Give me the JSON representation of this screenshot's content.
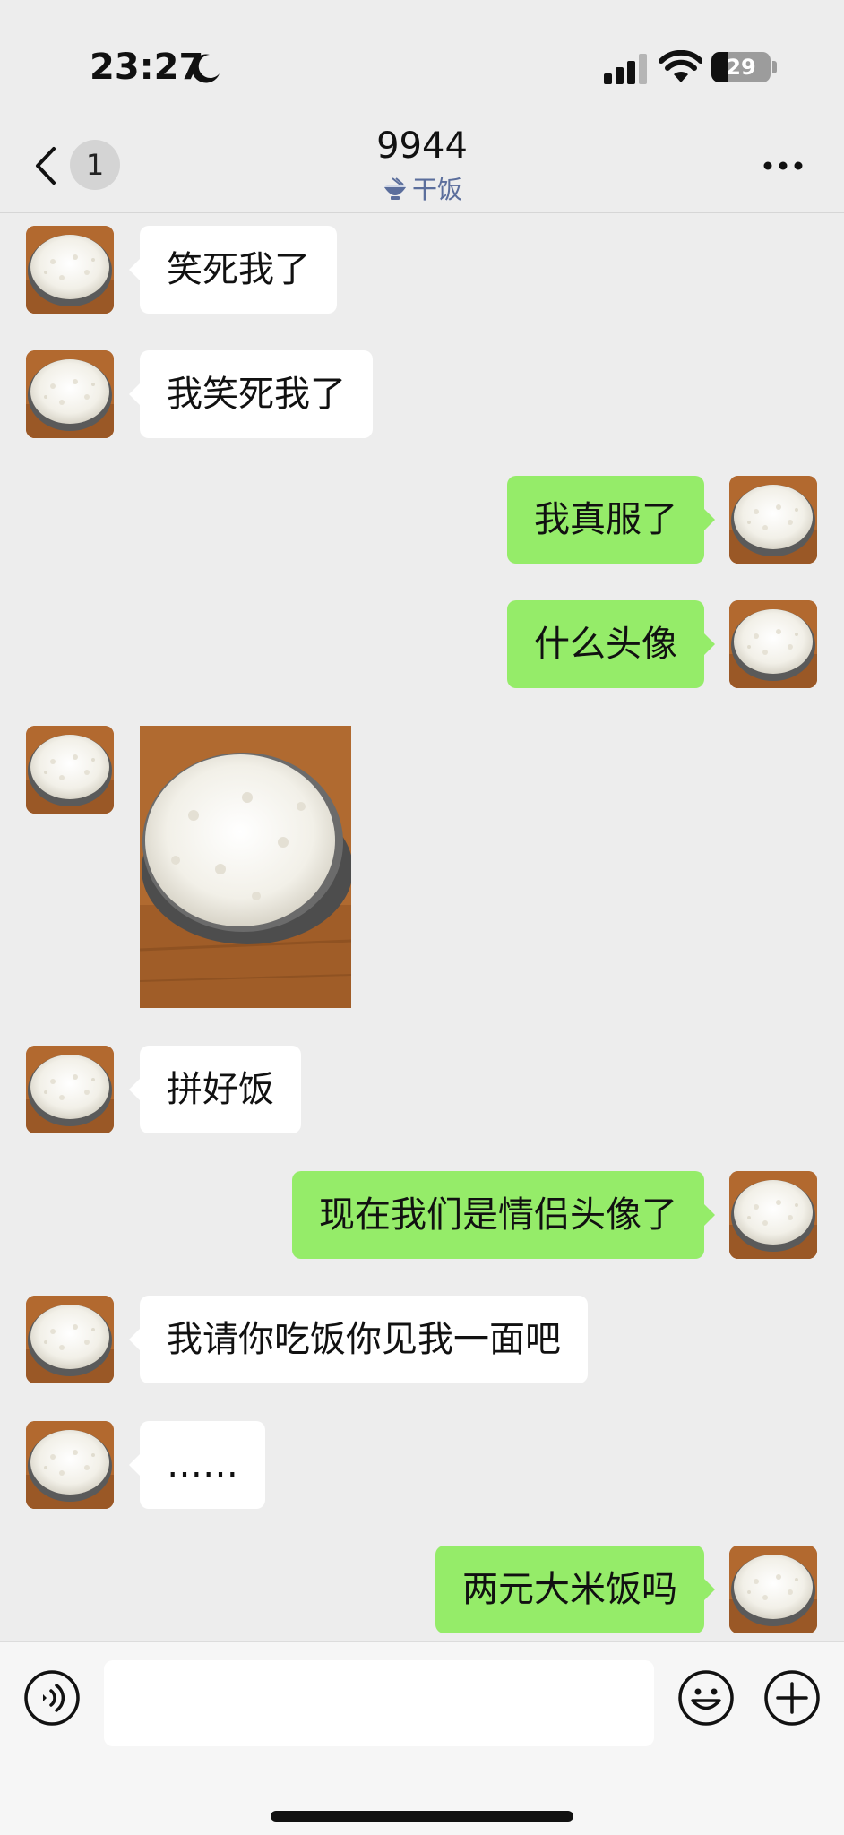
{
  "status_bar": {
    "time": "23:27",
    "battery": "29"
  },
  "nav": {
    "unread_count": "1",
    "title": "9944",
    "status_text": "干饭",
    "icons": {
      "back": "chevron-left-icon",
      "more": "more-dots-icon",
      "status": "rice-bowl-icon"
    }
  },
  "messages": [
    {
      "from": "them",
      "text": "笑死我了"
    },
    {
      "from": "them",
      "text": "我笑死我了"
    },
    {
      "from": "me",
      "text": "我真服了"
    },
    {
      "from": "me",
      "text": "什么头像"
    },
    {
      "from": "them",
      "type": "image",
      "image": "rice-bowl-photo"
    },
    {
      "from": "them",
      "text": "拼好饭"
    },
    {
      "from": "me",
      "text": "现在我们是情侣头像了"
    },
    {
      "from": "them",
      "text": "我请你吃饭你见我一面吧"
    },
    {
      "from": "them",
      "text": "……"
    },
    {
      "from": "me",
      "text": "两元大米饭吗"
    }
  ],
  "input_bar": {
    "input_value": "",
    "icons": {
      "voice": "voice-icon",
      "emoji": "emoji-icon",
      "more": "plus-icon"
    }
  },
  "colors": {
    "background": "#ededed",
    "outgoing_bubble": "#95ec69",
    "incoming_bubble": "#ffffff",
    "status_text": "#5b6e9c"
  }
}
